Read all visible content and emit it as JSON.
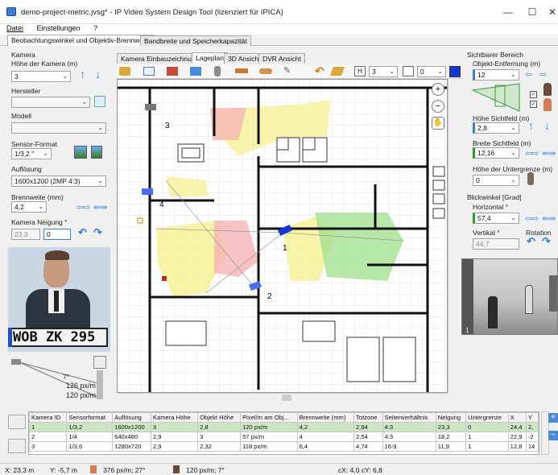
{
  "window": {
    "title": "demo-project-metric.jvsg* - IP Video System Design Tool (lizenziert für IPICA)",
    "minimize": "—",
    "maximize": "☐",
    "close": "✕"
  },
  "menu": {
    "items": [
      "Datei",
      "Einstellungen",
      "?"
    ]
  },
  "main_tabs": [
    "Beobachtungswinkel und Objektiv-Brennweite",
    "Bandbreite und Speicherkapazität"
  ],
  "left_panel": {
    "camera_section": "Kamera",
    "height_label": "Höhe der Kamera (m)",
    "height_value": "3",
    "manufacturer_label": "Hersteller",
    "manufacturer_value": "",
    "model_label": "Modell",
    "model_value": "",
    "sensor_label": "Sensor-Format",
    "sensor_value": "1/3,2 \"",
    "resolution_label": "Auflösung",
    "resolution_value": "1600x1200 (2MP 4:3)",
    "focal_label": "Brennweite (mm)",
    "focal_value": "4,2",
    "tilt_label": "Kamera Neigung °",
    "tilt_value_1": "23,3",
    "tilt_value_2": "0",
    "plate_text": "WOB ZK 295",
    "angle_text": "7°",
    "density_1": "126 px/m",
    "density_2": "120 px/m"
  },
  "plan_tabs": [
    "Kamera Einbauzeichnung",
    "Lageplan",
    "3D Ansicht",
    "DVR Ansicht"
  ],
  "toolbar2": {
    "h_label": "H",
    "h_value": "3",
    "v_value": "0"
  },
  "plan_labels": {
    "cam1": "1",
    "cam2": "2",
    "cam3": "3",
    "cam4": "4"
  },
  "right_panel": {
    "visible_section": "Sichtbarer Bereich",
    "distance_label": "Objekt-Entfernung (m)",
    "distance_value": "12",
    "fov_height_label": "Höhe Sichtfeld (m)",
    "fov_height_value": "2,8",
    "fov_width_label": "Breite Sichtfeld (m)",
    "fov_width_value": "12,16",
    "lower_bound_label": "Höhe der Untergrenze (m)",
    "lower_bound_value": "0",
    "view_angle_section": "Blickwinkel [Grad]",
    "horizontal_label": "Horizontal °",
    "horizontal_value": "57,4",
    "vertical_label": "Vertikal °",
    "vertical_value": "44,7",
    "rotation_label": "Rotation",
    "preview_label": "1"
  },
  "table": {
    "headers": [
      "Kamera ID",
      "Sensorformat",
      "Auflösung",
      "Kamera Höhe",
      "Objekt Höhe",
      "Pixel/m am Obj...",
      "Brennweite (mm)",
      "Totzone",
      "Seitenverhältnis",
      "Neigung",
      "Untergrenze",
      "X",
      "Y"
    ],
    "rows": [
      [
        "1",
        "1/3,2",
        "1600x1200",
        "3",
        "2,8",
        "120 px/m",
        "4,2",
        "2,94",
        "4:3",
        "23,3",
        "0",
        "24,4",
        "2,"
      ],
      [
        "2",
        "1/4",
        "640x480",
        "2,9",
        "3",
        "57 px/m",
        "4",
        "2,54",
        "4:3",
        "18,2",
        "1",
        "22,9",
        "-2"
      ],
      [
        "3",
        "1/3,6",
        "1280x720",
        "2,9",
        "2,32",
        "118 px/m",
        "6,4",
        "4,74",
        "16:9",
        "11,9",
        "1",
        "12,8",
        "14"
      ]
    ]
  },
  "status": {
    "x": "X: 23,3 m",
    "y": "Y: -5,7 m",
    "density_a": "376 px/m; 27°",
    "density_b": "120 px/m; 7°",
    "cxcy": "cX: 4,0 cY: 6,8"
  },
  "colors": {
    "accent": "#3a7fd6",
    "selected_row": "#cde7c4",
    "fov_green": "#9de08e",
    "fov_yellow": "#f5f08a",
    "fov_red": "#f6b4b4"
  }
}
